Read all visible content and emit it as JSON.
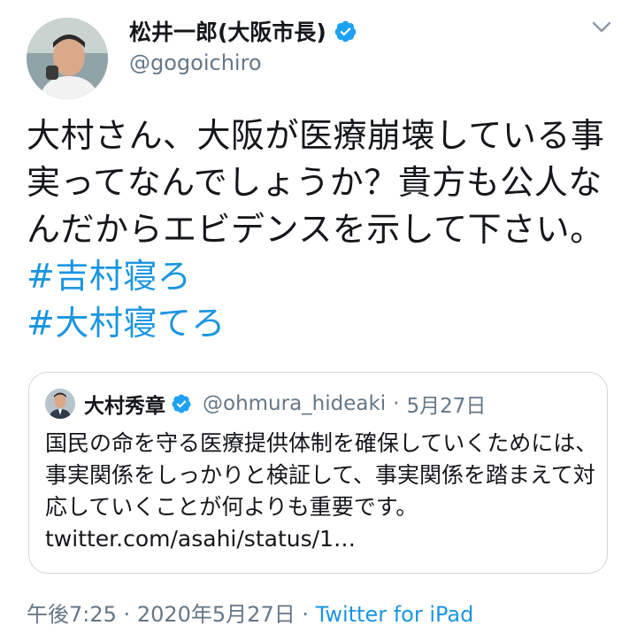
{
  "author": {
    "name": "松井一郎(大阪市長)",
    "handle": "@gogoichiro"
  },
  "tweet": {
    "text_plain": "大村さん、大阪が医療崩壊している事実ってなんでしょうか？貴方も公人なんだからエビデンスを示して下さい。",
    "hashtags": [
      "#吉村寝ろ",
      "#大村寝てろ"
    ]
  },
  "quoted": {
    "name": "大村秀章",
    "handle": "@ohmura_hideaki",
    "date": "5月27日",
    "separator": "·",
    "text_plain": "国民の命を守る医療提供体制を確保していくためには、事実関係をしっかりと検証して、事実関係を踏まえて対応していくことが何よりも重要です。",
    "link": "twitter.com/asahi/status/1…"
  },
  "meta": {
    "time": "午後7:25",
    "date": "2020年5月27日",
    "separator": "·",
    "source": "Twitter for iPad"
  },
  "colors": {
    "link": "#1b95e0",
    "verified": "#1da1f2",
    "secondary_text": "#657786",
    "border": "#ccd6dd"
  },
  "icons": [
    "verified-badge-icon",
    "chevron-down-icon"
  ]
}
